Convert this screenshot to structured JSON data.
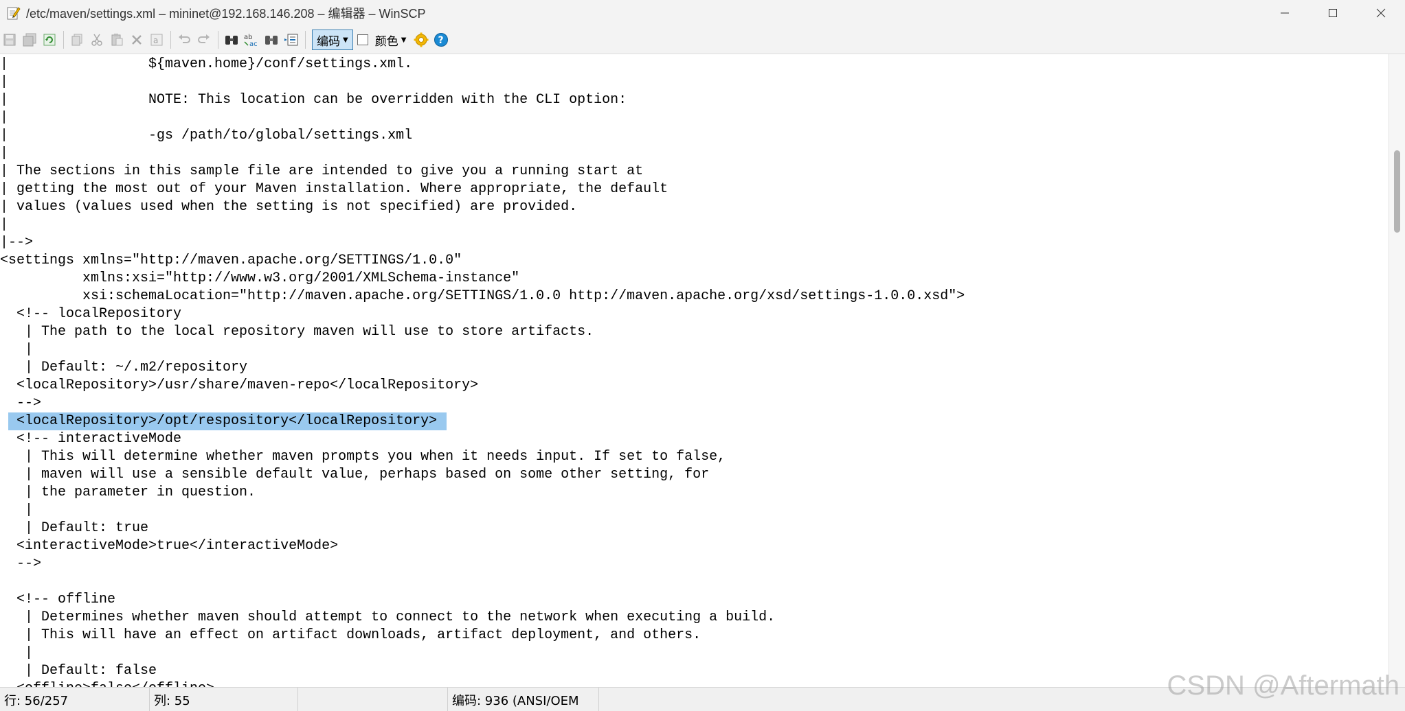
{
  "window": {
    "title": "/etc/maven/settings.xml – mininet@192.168.146.208 – 编辑器 – WinSCP"
  },
  "toolbar": {
    "encoding_label": "编码",
    "color_label": "颜色",
    "icons": [
      "save-icon",
      "save-all-icon",
      "reload-icon",
      "copy-icon",
      "cut-icon",
      "paste-icon",
      "delete-icon",
      "select-all-icon",
      "undo-icon",
      "redo-icon",
      "find-icon",
      "replace-icon",
      "find-next-icon",
      "goto-line-icon",
      "settings-icon",
      "help-icon"
    ]
  },
  "editor": {
    "lines": [
      "|                 ${maven.home}/conf/settings.xml.",
      "|",
      "|                 NOTE: This location can be overridden with the CLI option:",
      "|",
      "|                 -gs /path/to/global/settings.xml",
      "|",
      "| The sections in this sample file are intended to give you a running start at",
      "| getting the most out of your Maven installation. Where appropriate, the default",
      "| values (values used when the setting is not specified) are provided.",
      "|",
      "|-->",
      "<settings xmlns=\"http://maven.apache.org/SETTINGS/1.0.0\"",
      "          xmlns:xsi=\"http://www.w3.org/2001/XMLSchema-instance\"",
      "          xsi:schemaLocation=\"http://maven.apache.org/SETTINGS/1.0.0 http://maven.apache.org/xsd/settings-1.0.0.xsd\">",
      "  <!-- localRepository",
      "   | The path to the local repository maven will use to store artifacts.",
      "   |",
      "   | Default: ~/.m2/repository",
      "  <localRepository>/usr/share/maven-repo</localRepository>",
      "  -->",
      "  <localRepository>/opt/respository</localRepository>",
      "  <!-- interactiveMode",
      "   | This will determine whether maven prompts you when it needs input. If set to false,",
      "   | maven will use a sensible default value, perhaps based on some other setting, for",
      "   | the parameter in question.",
      "   |",
      "   | Default: true",
      "  <interactiveMode>true</interactiveMode>",
      "  -->",
      "",
      "  <!-- offline",
      "   | Determines whether maven should attempt to connect to the network when executing a build.",
      "   | This will have an effect on artifact downloads, artifact deployment, and others.",
      "   |",
      "   | Default: false",
      "  <offline>false</offline>"
    ],
    "selected_line_index": 20
  },
  "statusbar": {
    "line": "行: 56/257",
    "column": "列: 55",
    "encoding": "编码: 936  (ANSI/OEM"
  },
  "watermark": "CSDN @Aftermath"
}
